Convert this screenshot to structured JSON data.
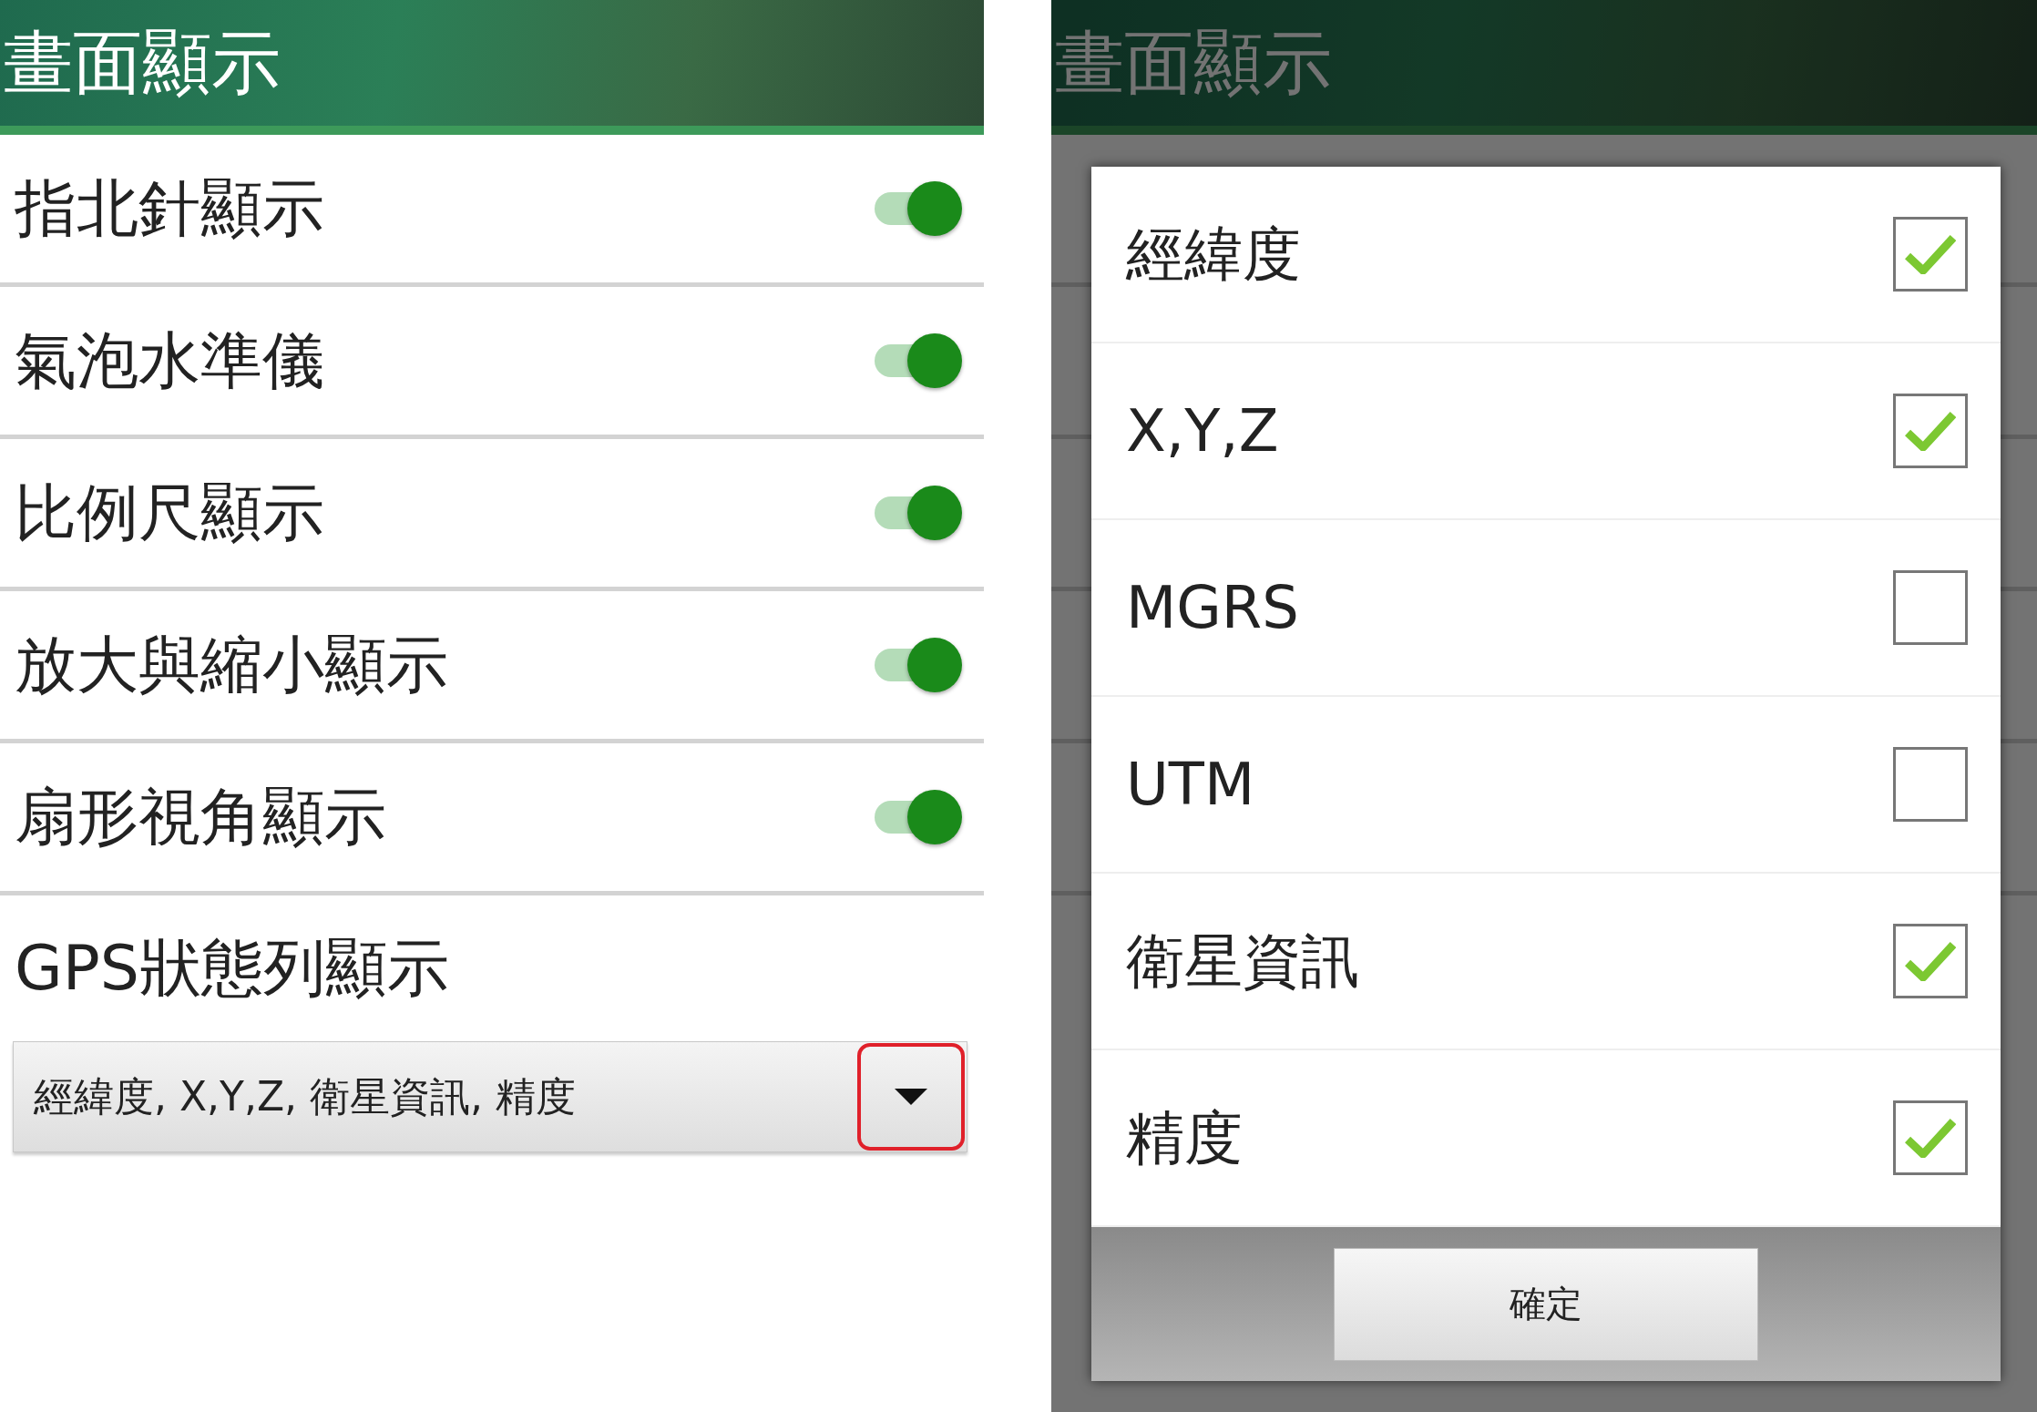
{
  "settings_screen": {
    "title": "畫面顯示",
    "toggles": [
      {
        "label": "指北針顯示",
        "on": true
      },
      {
        "label": "氣泡水準儀",
        "on": true
      },
      {
        "label": "比例尺顯示",
        "on": true
      },
      {
        "label": "放大與縮小顯示",
        "on": true
      },
      {
        "label": "扇形視角顯示",
        "on": true
      }
    ],
    "gps_bar": {
      "label": "GPS狀態列顯示",
      "value": "經緯度, X,Y,Z, 衛星資訊, 精度",
      "arrow_highlighted": true
    }
  },
  "dialog_screen": {
    "background_title": "畫面顯示",
    "options": [
      {
        "label": "經緯度",
        "checked": true
      },
      {
        "label": "X,Y,Z",
        "checked": true
      },
      {
        "label": "MGRS",
        "checked": false
      },
      {
        "label": "UTM",
        "checked": false
      },
      {
        "label": "衛星資訊",
        "checked": true
      },
      {
        "label": "精度",
        "checked": true
      }
    ],
    "confirm_button": "確定"
  }
}
